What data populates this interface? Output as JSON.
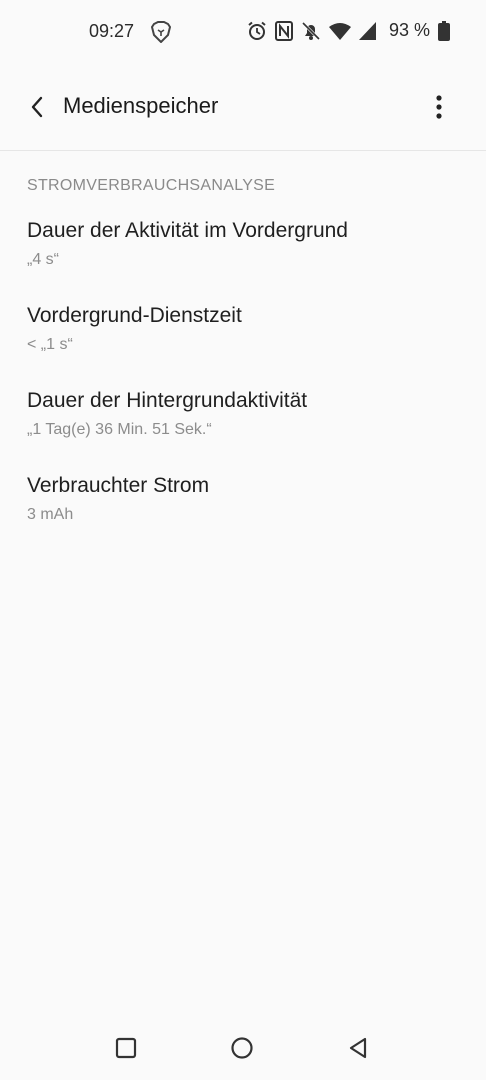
{
  "status_bar": {
    "time": "09:27",
    "battery": "93 %"
  },
  "app_bar": {
    "title": "Medienspeicher"
  },
  "section": {
    "header": "STROMVERBRAUCHSANALYSE",
    "items": [
      {
        "label": "Dauer der Aktivität im Vordergrund",
        "value": "„4 s“"
      },
      {
        "label": "Vordergrund-Dienstzeit",
        "value": "< „1 s“"
      },
      {
        "label": "Dauer der Hintergrundaktivität",
        "value": "„1 Tag(e) 36 Min. 51 Sek.“"
      },
      {
        "label": "Verbrauchter Strom",
        "value": "3 mAh"
      }
    ]
  }
}
